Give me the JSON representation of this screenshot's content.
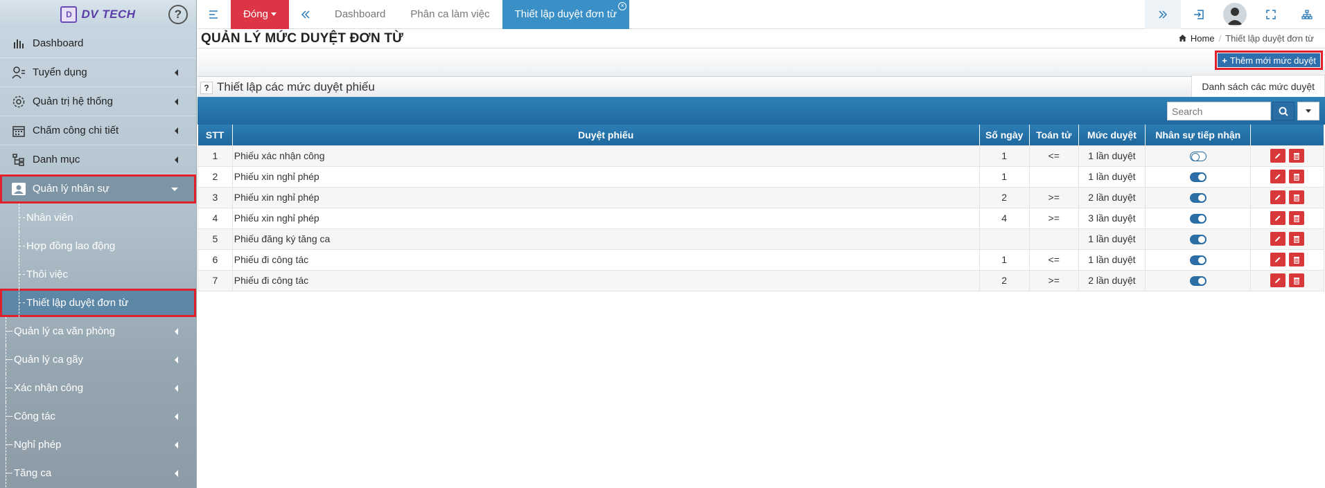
{
  "sidebar": {
    "logo": "DV TECH",
    "help": "?",
    "items": [
      {
        "label": "Dashboard"
      },
      {
        "label": "Tuyển dụng"
      },
      {
        "label": "Quản trị hệ thống"
      },
      {
        "label": "Chấm công chi tiết"
      },
      {
        "label": "Danh mục"
      },
      {
        "label": "Quản lý nhân sự"
      }
    ],
    "sub_items": [
      {
        "label": "Nhân viên"
      },
      {
        "label": "Hợp đồng lao động"
      },
      {
        "label": "Thôi việc"
      },
      {
        "label": "Thiết lập duyệt đơn từ"
      }
    ],
    "sections": [
      {
        "label": "Quản lý ca văn phòng"
      },
      {
        "label": "Quản lý ca gãy"
      },
      {
        "label": "Xác nhận công"
      },
      {
        "label": "Công tác"
      },
      {
        "label": "Nghỉ phép"
      },
      {
        "label": "Tăng ca"
      }
    ]
  },
  "topbar": {
    "close_label": "Đóng",
    "tabs": [
      "Dashboard",
      "Phân ca làm việc",
      "Thiết lập duyệt đơn từ"
    ]
  },
  "page": {
    "title": "QUẢN LÝ MỨC DUYỆT ĐƠN TỪ",
    "breadcrumb_home": "Home",
    "breadcrumb_current": "Thiết lập duyệt đơn từ",
    "add_button": "Thêm mới mức duyệt",
    "panel_title": "Thiết lập các mức duyệt phiếu",
    "list_tab": "Danh sách các mức duyệt",
    "search_placeholder": "Search"
  },
  "table": {
    "headers": [
      "STT",
      "Duyệt phiếu",
      "Số ngày",
      "Toán tử",
      "Mức duyệt",
      "Nhân sự tiếp nhận",
      ""
    ],
    "rows": [
      {
        "stt": "1",
        "name": "Phiếu xác nhận công",
        "days": "1",
        "op": "<=",
        "level": "1 lần duyệt",
        "toggle": false
      },
      {
        "stt": "2",
        "name": "Phiếu xin nghỉ phép",
        "days": "1",
        "op": "",
        "level": "1 lần duyệt",
        "toggle": true
      },
      {
        "stt": "3",
        "name": "Phiếu xin nghỉ phép",
        "days": "2",
        "op": ">=",
        "level": "2 lần duyệt",
        "toggle": true
      },
      {
        "stt": "4",
        "name": "Phiếu xin nghỉ phép",
        "days": "4",
        "op": ">=",
        "level": "3 lần duyệt",
        "toggle": true
      },
      {
        "stt": "5",
        "name": "Phiếu đăng ký tăng ca",
        "days": "",
        "op": "",
        "level": "1 lần duyệt",
        "toggle": true
      },
      {
        "stt": "6",
        "name": "Phiếu đi công tác",
        "days": "1",
        "op": "<=",
        "level": "1 lần duyệt",
        "toggle": true
      },
      {
        "stt": "7",
        "name": "Phiếu đi công tác",
        "days": "2",
        "op": ">=",
        "level": "2 lần duyệt",
        "toggle": true
      }
    ]
  },
  "colors": {
    "accent": "#2a6ea5",
    "danger": "#dc3545",
    "highlight": "#e0202a"
  }
}
